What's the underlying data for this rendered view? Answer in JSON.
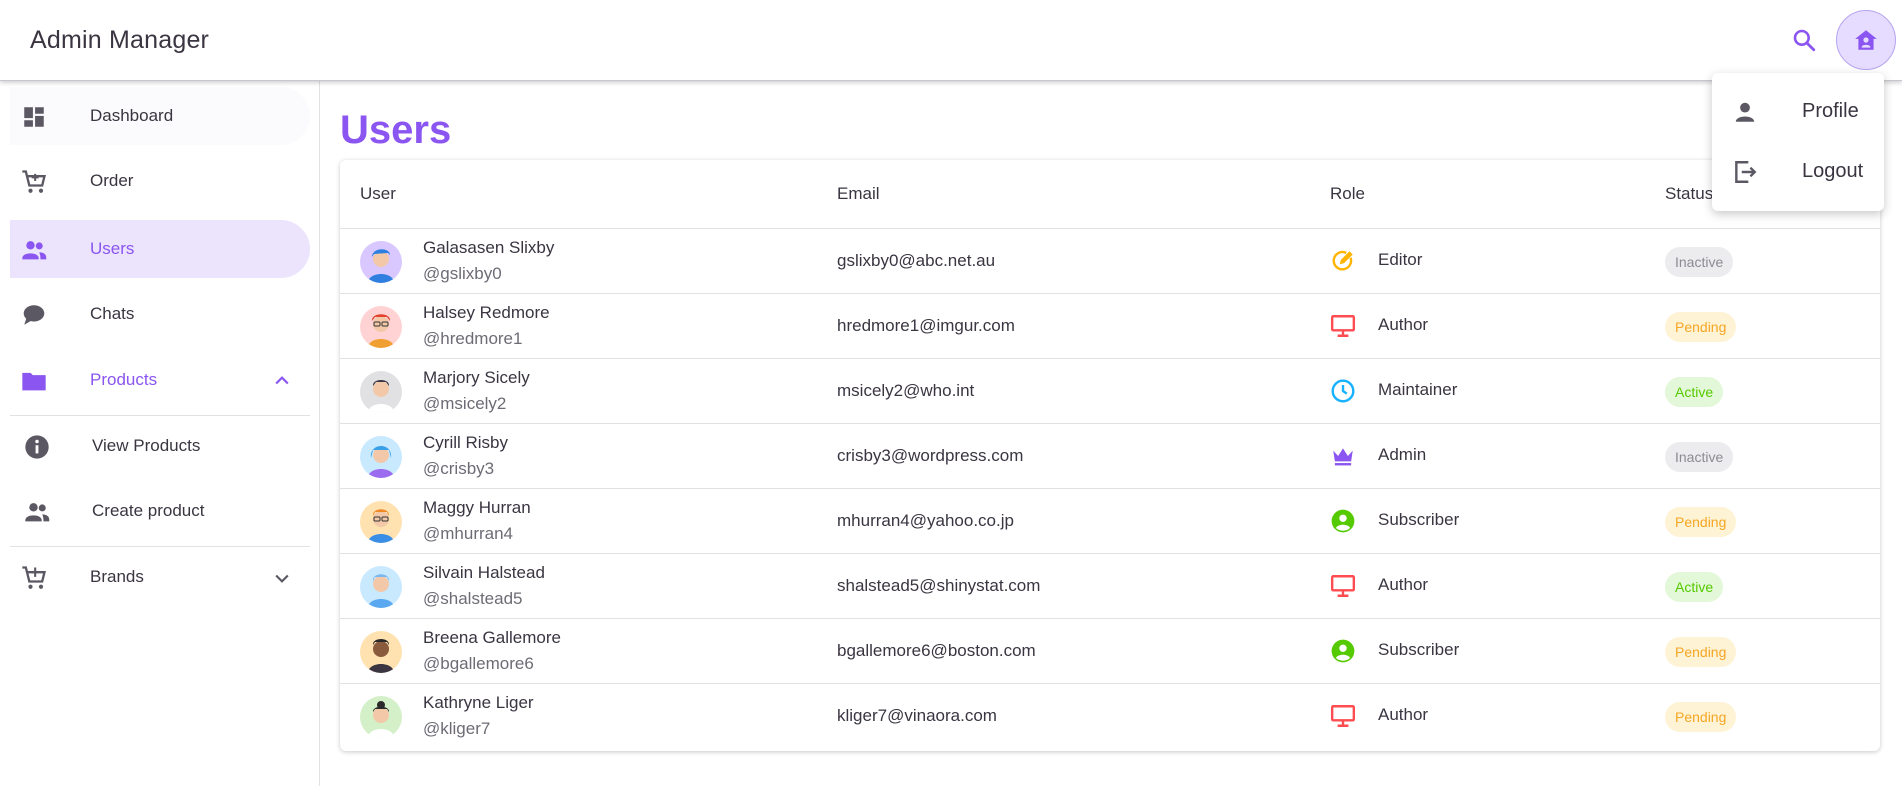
{
  "header": {
    "title": "Admin Manager",
    "search_icon": "search-icon",
    "home_icon": "home-account-icon"
  },
  "sidebar": {
    "items": [
      {
        "label": "Dashboard",
        "icon": "dashboard-icon"
      },
      {
        "label": "Order",
        "icon": "cart-icon"
      },
      {
        "label": "Users",
        "icon": "users-icon",
        "active": true
      },
      {
        "label": "Chats",
        "icon": "chat-icon"
      },
      {
        "label": "Products",
        "icon": "folder-icon",
        "expanded": true
      },
      {
        "label": "View Products",
        "icon": "info-icon"
      },
      {
        "label": "Create product",
        "icon": "people-icon"
      },
      {
        "label": "Brands",
        "icon": "cart-plus-icon",
        "expanded": false
      }
    ]
  },
  "page": {
    "title": "Users"
  },
  "table": {
    "columns": [
      "User",
      "Email",
      "Role",
      "Status"
    ],
    "rows": [
      {
        "name": "Galasasen Slixby",
        "handle": "@gslixby0",
        "email": "gslixby0@abc.net.au",
        "role": "Editor",
        "status": "Inactive"
      },
      {
        "name": "Halsey Redmore",
        "handle": "@hredmore1",
        "email": "hredmore1@imgur.com",
        "role": "Author",
        "status": "Pending"
      },
      {
        "name": "Marjory Sicely",
        "handle": "@msicely2",
        "email": "msicely2@who.int",
        "role": "Maintainer",
        "status": "Active"
      },
      {
        "name": "Cyrill Risby",
        "handle": "@crisby3",
        "email": "crisby3@wordpress.com",
        "role": "Admin",
        "status": "Inactive"
      },
      {
        "name": "Maggy Hurran",
        "handle": "@mhurran4",
        "email": "mhurran4@yahoo.co.jp",
        "role": "Subscriber",
        "status": "Pending"
      },
      {
        "name": "Silvain Halstead",
        "handle": "@shalstead5",
        "email": "shalstead5@shinystat.com",
        "role": "Author",
        "status": "Active"
      },
      {
        "name": "Breena Gallemore",
        "handle": "@bgallemore6",
        "email": "bgallemore6@boston.com",
        "role": "Subscriber",
        "status": "Pending"
      },
      {
        "name": "Kathryne Liger",
        "handle": "@kliger7",
        "email": "kliger7@vinaora.com",
        "role": "Author",
        "status": "Pending"
      }
    ]
  },
  "dropdown": {
    "items": [
      {
        "label": "Profile",
        "icon": "person-icon"
      },
      {
        "label": "Logout",
        "icon": "logout-icon"
      }
    ]
  },
  "colors": {
    "accent": "#8a55f0",
    "editor": "#ffb400",
    "author": "#ff4c51",
    "maintainer": "#16b1ff",
    "admin": "#8a55f0",
    "subscriber": "#56ca00"
  }
}
